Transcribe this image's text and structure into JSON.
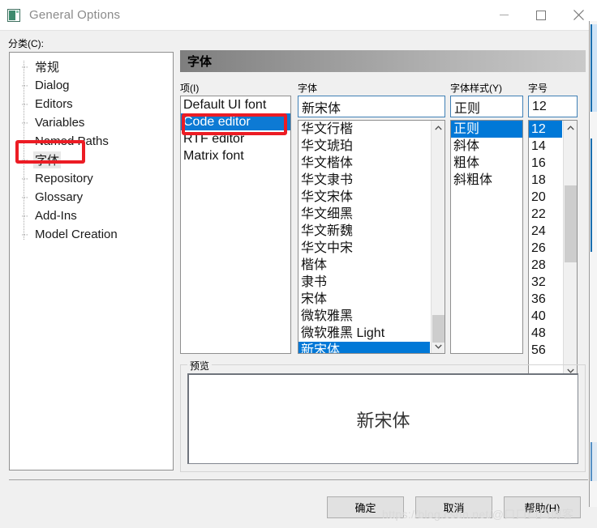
{
  "window": {
    "title": "General Options",
    "icon": "app-icon",
    "controls": [
      {
        "name": "minimize",
        "glyph": "minimize-icon"
      },
      {
        "name": "maximize",
        "glyph": "maximize-icon"
      },
      {
        "name": "close",
        "glyph": "close-icon"
      }
    ]
  },
  "categories": {
    "label": "分类(C):",
    "selected": "字体",
    "items": [
      {
        "label": "常规"
      },
      {
        "label": "Dialog"
      },
      {
        "label": "Editors"
      },
      {
        "label": "Variables"
      },
      {
        "label": "Named Paths"
      },
      {
        "label": "字体"
      },
      {
        "label": "Repository"
      },
      {
        "label": "Glossary"
      },
      {
        "label": "Add-Ins"
      },
      {
        "label": "Model Creation"
      }
    ]
  },
  "section": {
    "header": "字体"
  },
  "item_column": {
    "label": "项(I)",
    "selected": "Code editor",
    "items": [
      "Default UI font",
      "Code editor",
      "RTF editor",
      "Matrix font"
    ]
  },
  "font_column": {
    "label": "字体",
    "value": "新宋体",
    "selected": "新宋体",
    "items": [
      "华文行楷",
      "华文琥珀",
      "华文楷体",
      "华文隶书",
      "华文宋体",
      "华文细黑",
      "华文新魏",
      "华文中宋",
      "楷体",
      "隶书",
      "宋体",
      "微软雅黑",
      "微软雅黑 Light",
      "新宋体"
    ]
  },
  "style_column": {
    "label": "字体样式(Y)",
    "value": "正则",
    "selected": "正则",
    "items": [
      "正则",
      "斜体",
      "粗体",
      "斜粗体"
    ]
  },
  "size_column": {
    "label": "字号",
    "value": "12",
    "selected": "12",
    "items": [
      "12",
      "14",
      "16",
      "18",
      "20",
      "22",
      "24",
      "26",
      "28",
      "32",
      "36",
      "40",
      "48",
      "56"
    ]
  },
  "preview": {
    "label": "预览",
    "text": "新宋体"
  },
  "buttons": {
    "ok": "确定",
    "cancel": "取消",
    "help": "帮助(H)"
  },
  "watermark": "https://blog.csdn.net/@口口口口博客",
  "colors": {
    "selection": "#0078d7",
    "annotation": "#ec1c24",
    "combo_border": "#3f7fb5",
    "header_gradient_start": "#7e7e7e",
    "header_gradient_end": "#c9c9c9"
  }
}
